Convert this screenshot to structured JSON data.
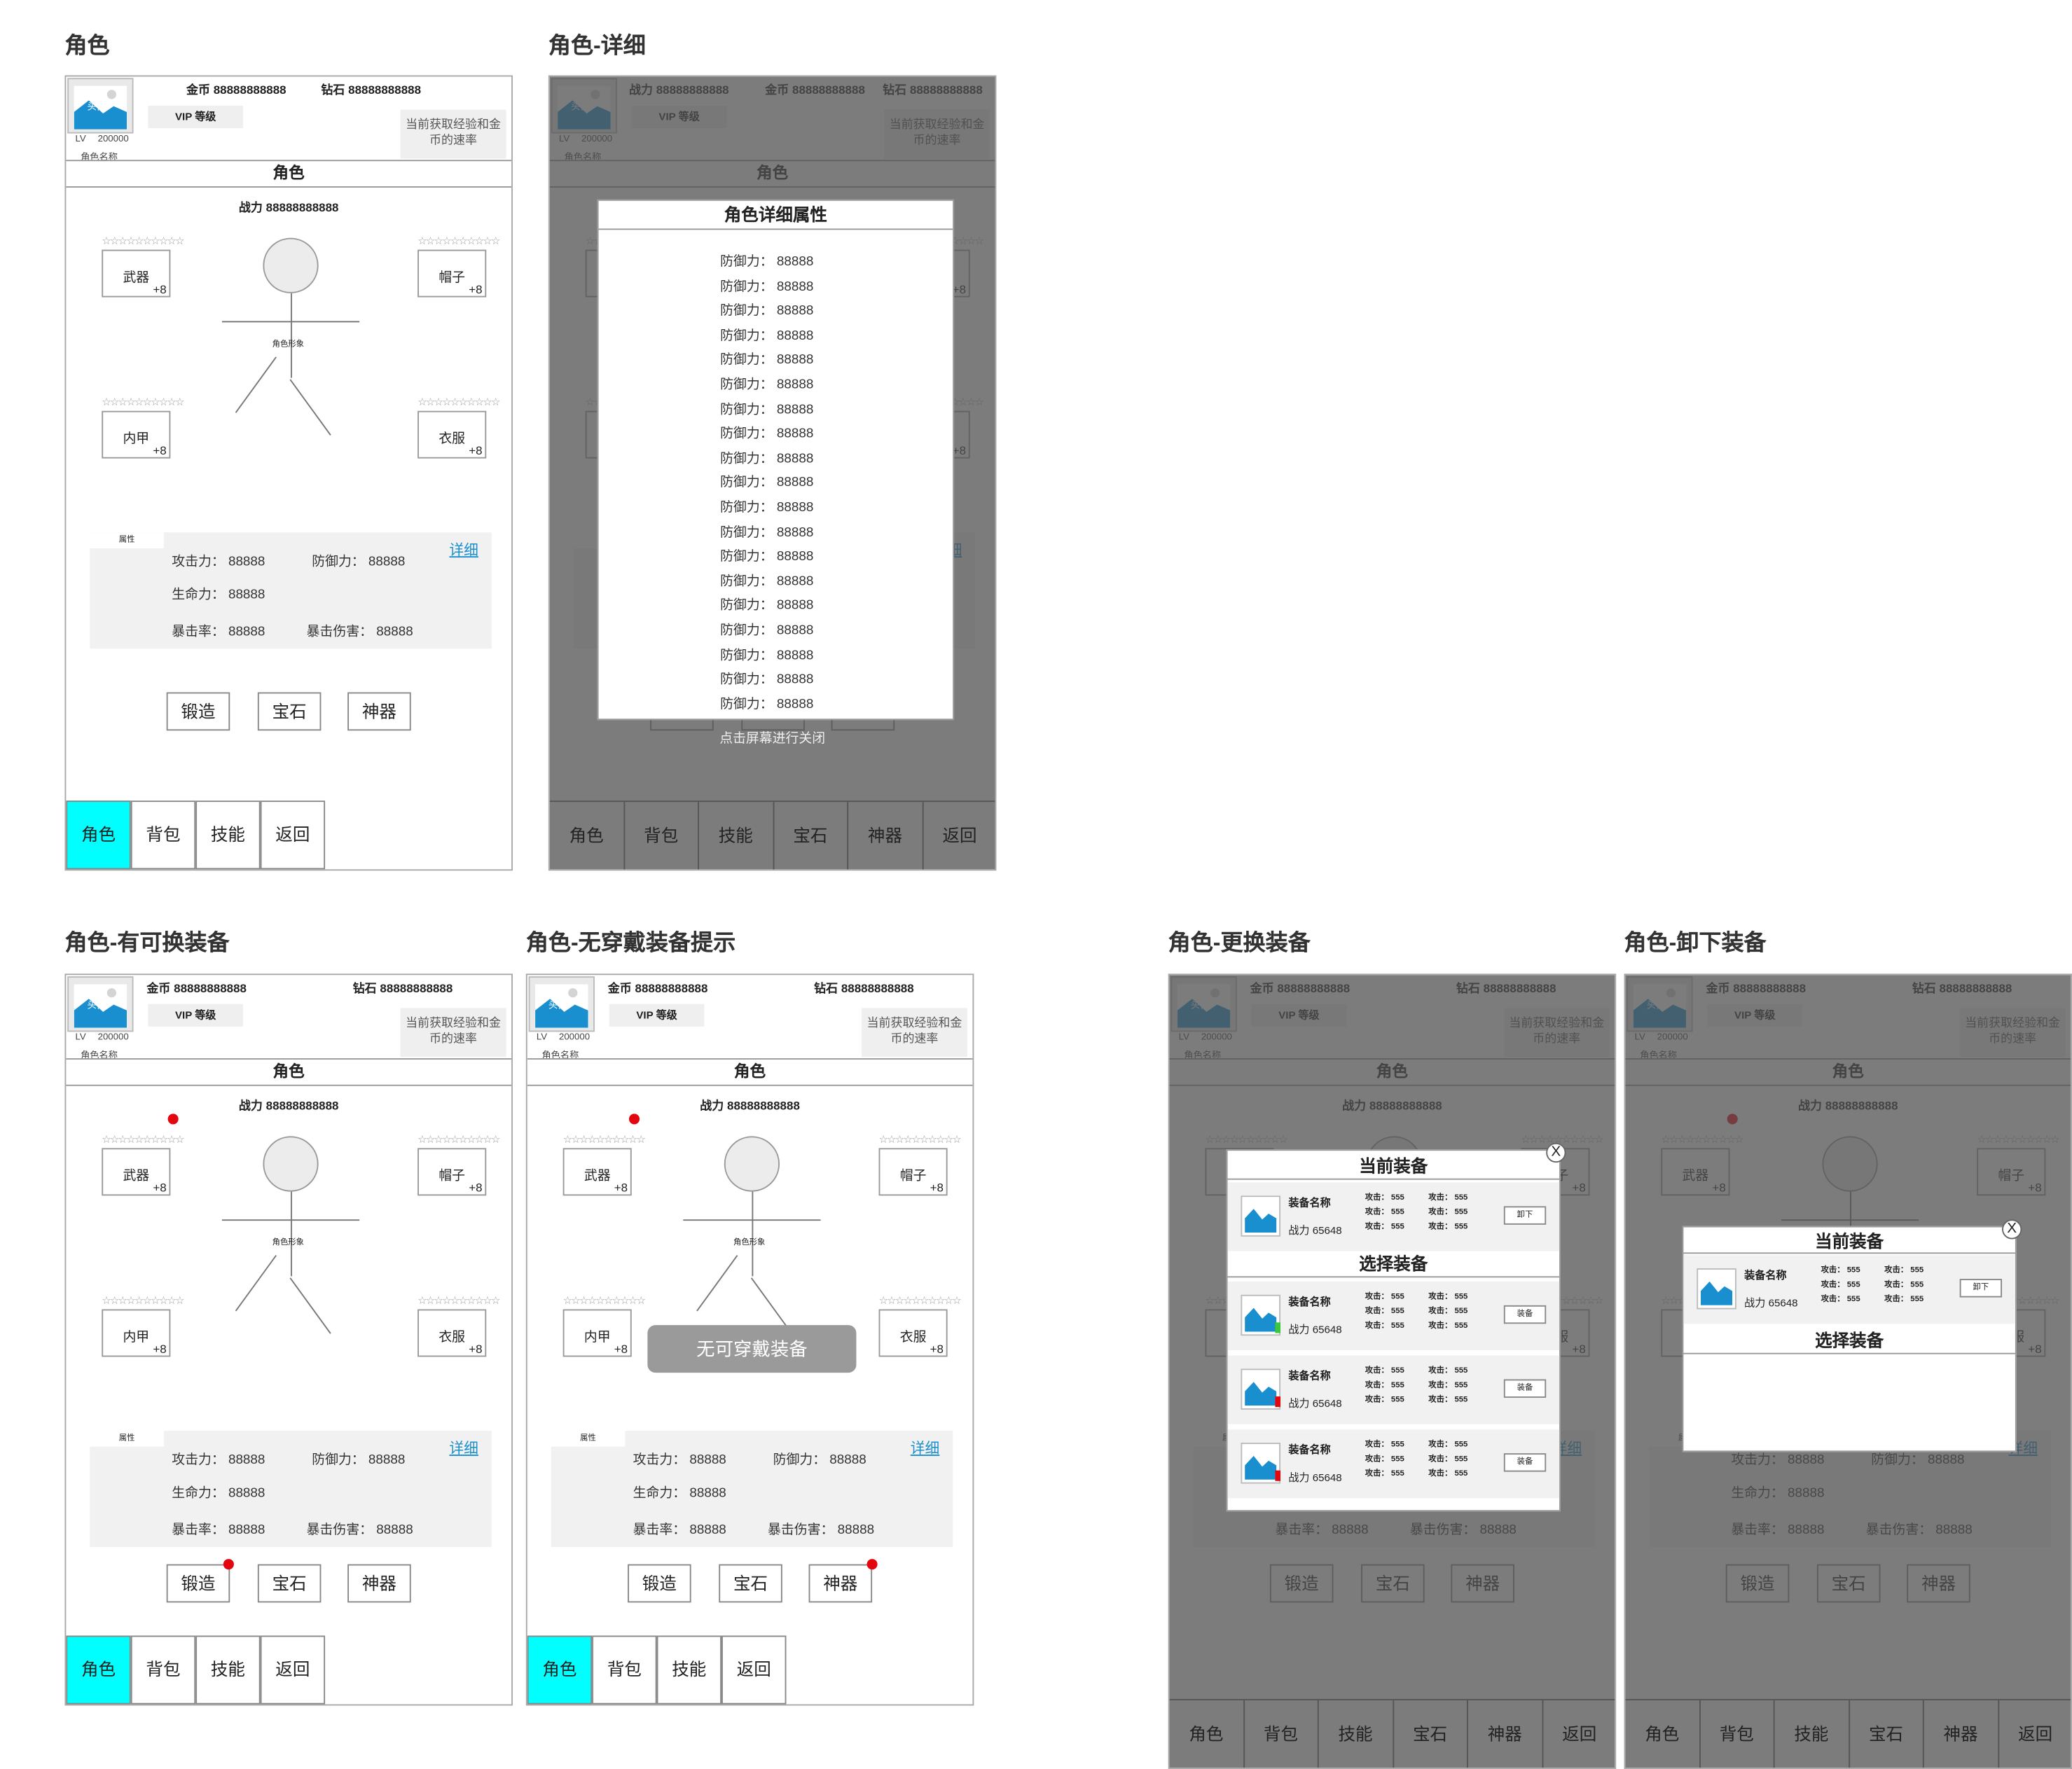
{
  "sections": [
    "角色",
    "角色-详细",
    "角色-有可换装备",
    "角色-无穿戴装备提示",
    "角色-更换装备",
    "角色-卸下装备"
  ],
  "header": {
    "avatar_text": "头像",
    "lv_label": "LV",
    "lv_value": "200000",
    "name": "角色名称",
    "gold_label": "金币",
    "gold_value": "88888888888",
    "diamond_label": "钻石",
    "diamond_value": "88888888888",
    "vip": "VIP 等级",
    "rate": "当前获取经验和金币的速率",
    "power_label": "战力",
    "power_value": "88888888888"
  },
  "page_title": "角色",
  "figure_label": "角色形象",
  "stars": "☆☆☆☆☆☆☆☆☆☆",
  "slots": [
    {
      "name": "武器",
      "plus": "+8"
    },
    {
      "name": "帽子",
      "plus": "+8"
    },
    {
      "name": "内甲",
      "plus": "+8"
    },
    {
      "name": "衣服",
      "plus": "+8"
    }
  ],
  "attributes": {
    "tab": "属性",
    "detail_link": "详细",
    "attack_label": "攻击力：",
    "attack_value": "88888",
    "defense_label": "防御力：",
    "defense_value": "88888",
    "hp_label": "生命力：",
    "hp_value": "88888",
    "crit_label": "暴击率：",
    "crit_value": "88888",
    "critdmg_label": "暴击伤害：",
    "critdmg_value": "88888"
  },
  "actions": [
    "锻造",
    "宝石",
    "神器"
  ],
  "nav4": [
    "角色",
    "背包",
    "技能",
    "返回"
  ],
  "nav6": [
    "角色",
    "背包",
    "技能",
    "宝石",
    "神器",
    "返回"
  ],
  "detail_modal": {
    "title": "角色详细属性",
    "row_label": "防御力：",
    "row_value": "88888",
    "close_hint": "点击屏幕进行关闭"
  },
  "toast": "无可穿戴装备",
  "equip_modal": {
    "current_title": "当前装备",
    "select_title": "选择装备",
    "close": "X",
    "equip_name": "装备名称",
    "power_label": "战力",
    "power_value": "65648",
    "stat_label": "攻击：",
    "stat_value": "555",
    "unequip": "卸下",
    "equip": "装备"
  },
  "colors": {
    "active_tab": "#00ffff",
    "link": "#1a8fd0",
    "red_dot": "#e4060e",
    "green_mark": "#3cc83c",
    "overlay": "#505050"
  }
}
